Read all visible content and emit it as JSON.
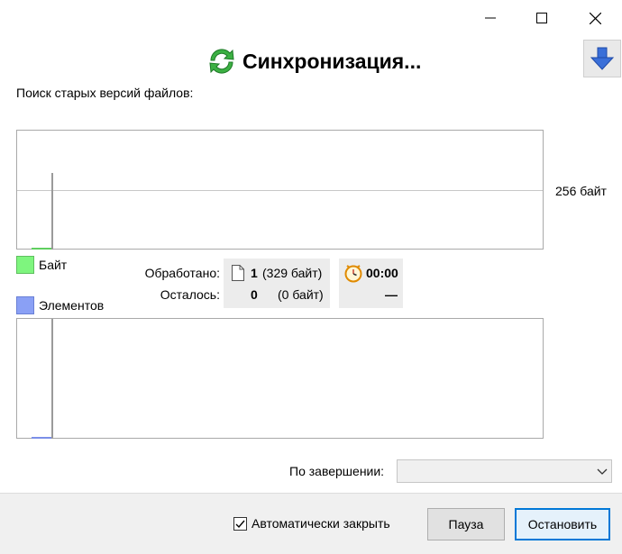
{
  "window": {
    "controls": [
      "minimize-icon",
      "maximize-icon",
      "close-icon"
    ]
  },
  "header": {
    "title": "Синхронизация...",
    "icon": "sync-arrows-icon",
    "collapse_icon": "arrow-down-icon"
  },
  "status": {
    "text": "Поиск старых версий файлов:"
  },
  "graph": {
    "scale_label": "256 байт",
    "colors": {
      "bytes": "#5fcf5f",
      "items": "#7b8fe8"
    }
  },
  "legend": {
    "bytes": "Байт",
    "items": "Элементов"
  },
  "stats": {
    "processed_label": "Обработано:",
    "remaining_label": "Осталось:",
    "processed_count": "1",
    "processed_size": "(329 байт)",
    "remaining_count": "0",
    "remaining_size": "(0 байт)",
    "elapsed": "00:00",
    "remaining_time": "—"
  },
  "finish": {
    "label": "По завершении:",
    "value": ""
  },
  "footer": {
    "auto_close_label": "Автоматически закрыть",
    "auto_close_checked": true,
    "pause_label": "Пауза",
    "stop_label": "Остановить",
    "accent": "#0078d7"
  }
}
